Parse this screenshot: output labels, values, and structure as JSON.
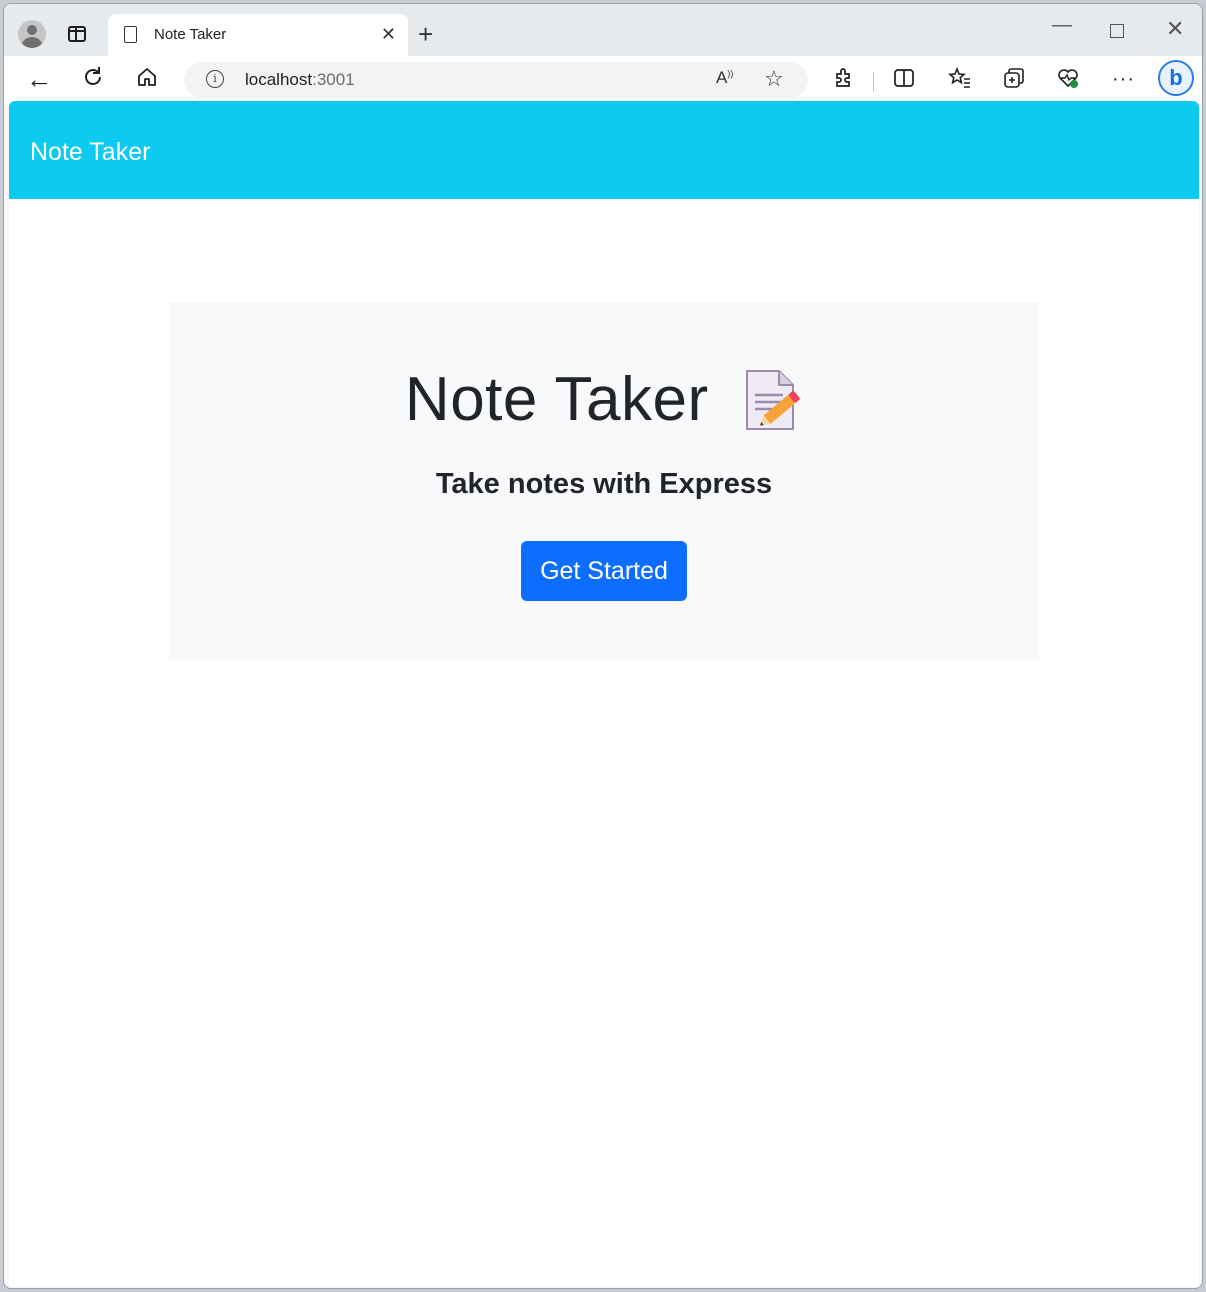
{
  "browser": {
    "tab": {
      "title": "Note Taker"
    },
    "new_tab_label": "+",
    "address_bar": {
      "host": "localhost",
      "port": ":3001"
    },
    "window_controls": {
      "minimize": "—",
      "close": "✕"
    },
    "more_label": "···",
    "bing_label": "b"
  },
  "navbar": {
    "brand": "Note Taker"
  },
  "hero": {
    "title": "Note Taker",
    "subtitle": "Take notes with Express",
    "cta_label": "Get Started"
  },
  "colors": {
    "navbar_bg": "#0dcaf0",
    "jumbotron_bg": "#f8f9fa",
    "cta_bg": "#0d6efd"
  }
}
